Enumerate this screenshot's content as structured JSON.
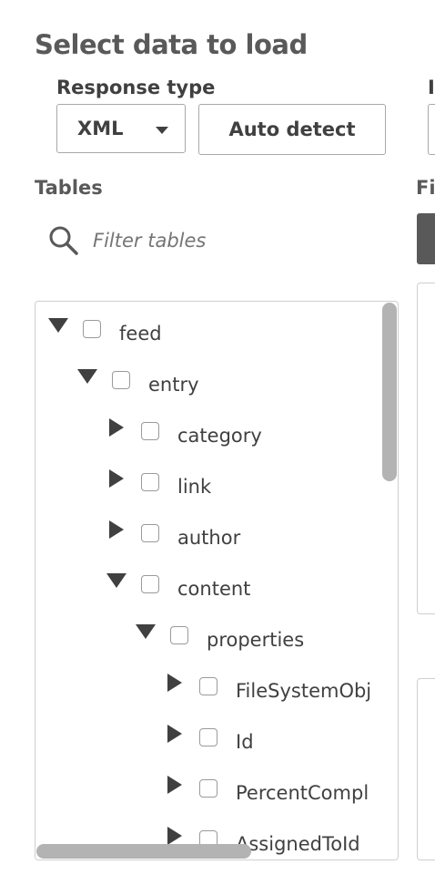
{
  "page": {
    "title": "Select data to load"
  },
  "response": {
    "label": "Response type",
    "selected": "XML",
    "auto_detect_label": "Auto detect"
  },
  "right_cut": {
    "label_fragment": "I",
    "fields_fragment": "Fi"
  },
  "tables": {
    "label": "Tables",
    "filter_placeholder": "Filter tables",
    "tree": [
      {
        "label": "feed",
        "expanded": true,
        "level": 0
      },
      {
        "label": "entry",
        "expanded": true,
        "level": 1
      },
      {
        "label": "category",
        "expanded": false,
        "level": 2
      },
      {
        "label": "link",
        "expanded": false,
        "level": 2
      },
      {
        "label": "author",
        "expanded": false,
        "level": 2
      },
      {
        "label": "content",
        "expanded": true,
        "level": 2
      },
      {
        "label": "properties",
        "expanded": true,
        "level": 3
      },
      {
        "label": "FileSystemObj",
        "expanded": false,
        "level": 4
      },
      {
        "label": "Id",
        "expanded": false,
        "level": 4
      },
      {
        "label": "PercentCompl",
        "expanded": false,
        "level": 4
      },
      {
        "label": "AssignedToId",
        "expanded": false,
        "level": 4
      }
    ]
  },
  "icons": {
    "search": "search-icon",
    "expand": "triangle-down-icon",
    "collapse": "triangle-right-icon"
  }
}
